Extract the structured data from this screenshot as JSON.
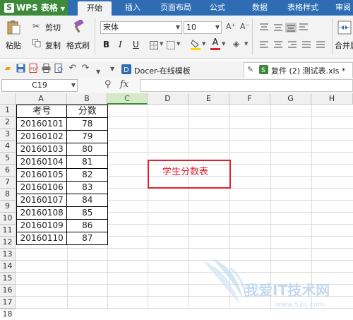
{
  "app": {
    "name": "WPS 表格"
  },
  "ribbon_tabs": [
    "开始",
    "插入",
    "页面布局",
    "公式",
    "数据",
    "表格样式",
    "审阅"
  ],
  "toolbar": {
    "cut": "剪切",
    "paste": "粘贴",
    "copy": "复制",
    "format_painter": "格式刷",
    "font_name": "宋体",
    "font_size": "10",
    "merge": "合并居",
    "grow_font": "A⁺",
    "shrink_font": "A⁻",
    "bold": "B",
    "italic": "I",
    "underline": "U",
    "font_color": "A"
  },
  "document_tabs": {
    "docer": "Docer-在线模板",
    "file": "复件 (2) 测试表.xls *"
  },
  "formula_bar": {
    "name_box": "C19",
    "fx": "fx",
    "value": ""
  },
  "columns": [
    "A",
    "B",
    "C",
    "D",
    "E",
    "F",
    "G",
    "H"
  ],
  "rows": [
    "1",
    "2",
    "3",
    "4",
    "5",
    "6",
    "7",
    "8",
    "9",
    "10",
    "11",
    "12",
    "13",
    "14",
    "15",
    "16",
    "17",
    "18"
  ],
  "sheet": {
    "header": [
      "考号",
      "分数"
    ],
    "records": [
      [
        "20160101",
        "78"
      ],
      [
        "20160102",
        "79"
      ],
      [
        "20160103",
        "80"
      ],
      [
        "20160104",
        "81"
      ],
      [
        "20160105",
        "82"
      ],
      [
        "20160106",
        "83"
      ],
      [
        "20160107",
        "84"
      ],
      [
        "20160108",
        "85"
      ],
      [
        "20160109",
        "86"
      ],
      [
        "20160110",
        "87"
      ]
    ]
  },
  "annotation": "学生分数表",
  "watermark": {
    "text": "我爱IT技术网",
    "url": "www.52ij.com"
  },
  "colors": {
    "accent": "#2e6db4",
    "wps_green": "#3c8a3a",
    "annotation_red": "#e2202a"
  }
}
